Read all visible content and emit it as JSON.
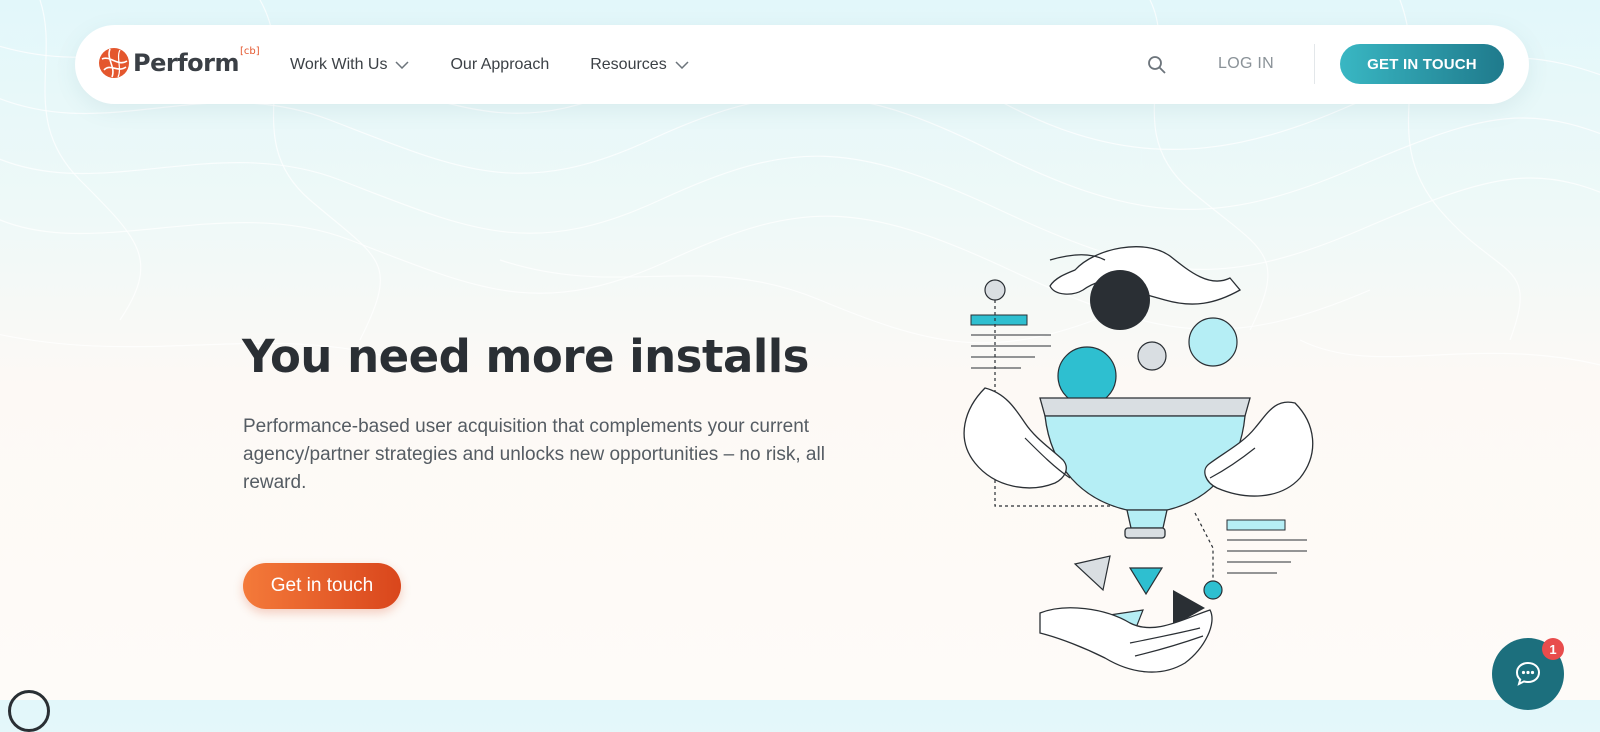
{
  "nav": {
    "logo_text": "Perform",
    "logo_sup": "[cb]",
    "items": [
      {
        "label": "Work With Us",
        "has_dropdown": true
      },
      {
        "label": "Our Approach",
        "has_dropdown": false
      },
      {
        "label": "Resources",
        "has_dropdown": true
      }
    ],
    "search_icon": "search-icon",
    "login_label": "LOG IN",
    "cta_label": "GET IN TOUCH"
  },
  "hero": {
    "title": "You need more installs",
    "subtitle": "Performance-based user acquisition that complements your current agency/partner strategies and unlocks new opportunities – no risk, all reward.",
    "cta_label": "Get in touch"
  },
  "chat": {
    "icon": "chat-bubble-icon",
    "badge_count": "1"
  },
  "colors": {
    "brand_orange": "#e4572e",
    "teal": "#1f7a8c",
    "cyan": "#2ebfd0",
    "text_dark": "#2a2f34"
  }
}
